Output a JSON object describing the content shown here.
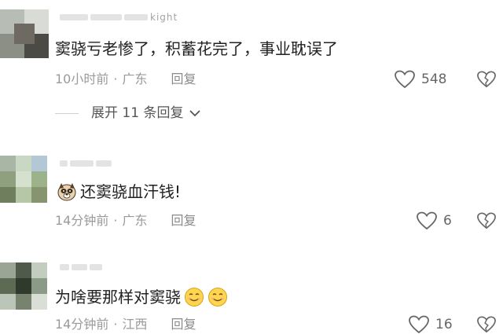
{
  "comments": [
    {
      "username": "kight",
      "text": "窦骁亏老惨了，积蓄花完了，事业耽误了",
      "time": "10小时前",
      "location": "广东",
      "reply_label": "回复",
      "likes": "548",
      "expand_label": "展开 11 条回复",
      "avatar_icon": "pixelated-avatar",
      "like_icon": "heart-outline-icon",
      "dislike_icon": "broken-heart-icon"
    },
    {
      "username": "",
      "text": "还窦骁血汗钱!",
      "time": "14分钟前",
      "location": "广东",
      "reply_label": "回复",
      "likes": "6",
      "avatar_icon": "pixelated-avatar",
      "emoji_icon": "dog-emoji-icon",
      "like_icon": "heart-outline-icon",
      "dislike_icon": "broken-heart-icon"
    },
    {
      "username": "",
      "text": "为啥要那样对窦骁",
      "time": "14分钟前",
      "location": "江西",
      "reply_label": "回复",
      "likes": "16",
      "avatar_icon": "pixelated-avatar",
      "emoji_icon": "smiley-emoji-icon",
      "like_icon": "heart-outline-icon",
      "dislike_icon": "broken-heart-icon"
    }
  ],
  "colors": {
    "text": "#222222",
    "meta": "#9a9a9a",
    "icon": "#666666"
  }
}
